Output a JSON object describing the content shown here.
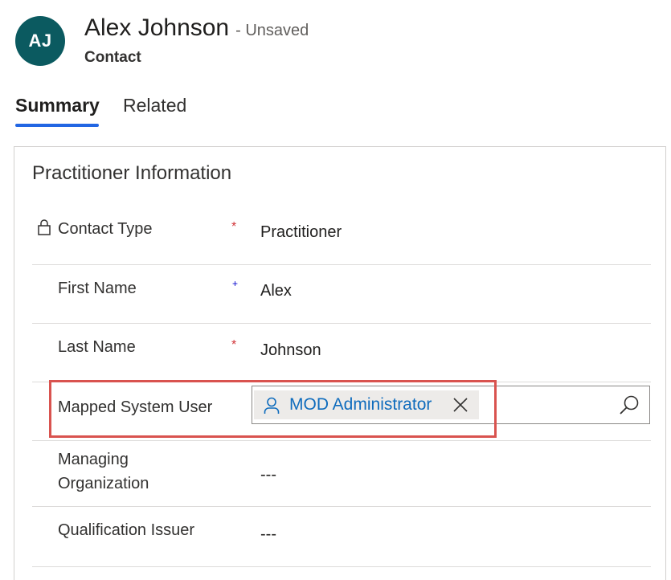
{
  "header": {
    "initials": "AJ",
    "name": "Alex Johnson",
    "status": "- Unsaved",
    "entity_type": "Contact",
    "avatar_color": "#0b5a60"
  },
  "tabs": [
    {
      "label": "Summary",
      "active": true
    },
    {
      "label": "Related",
      "active": false
    }
  ],
  "section": {
    "title": "Practitioner Information",
    "fields": {
      "contact_type": {
        "label": "Contact Type",
        "value": "Practitioner",
        "required": "*",
        "locked": true
      },
      "first_name": {
        "label": "First Name",
        "value": "Alex",
        "recommended": "+"
      },
      "last_name": {
        "label": "Last Name",
        "value": "Johnson",
        "required": "*"
      },
      "mapped_system_user": {
        "label": "Mapped System User",
        "value": "MOD Administrator",
        "icon": "person-icon",
        "search_icon": "search-icon"
      },
      "managing_organization": {
        "label_line1": "Managing",
        "label_line2": "Organization",
        "value": "---"
      },
      "qualification_issuer": {
        "label": "Qualification Issuer",
        "value": "---"
      }
    }
  },
  "colors": {
    "accent": "#2266e3",
    "required": "#d13438",
    "link": "#0f6cbd",
    "highlight": "#d9534f"
  }
}
